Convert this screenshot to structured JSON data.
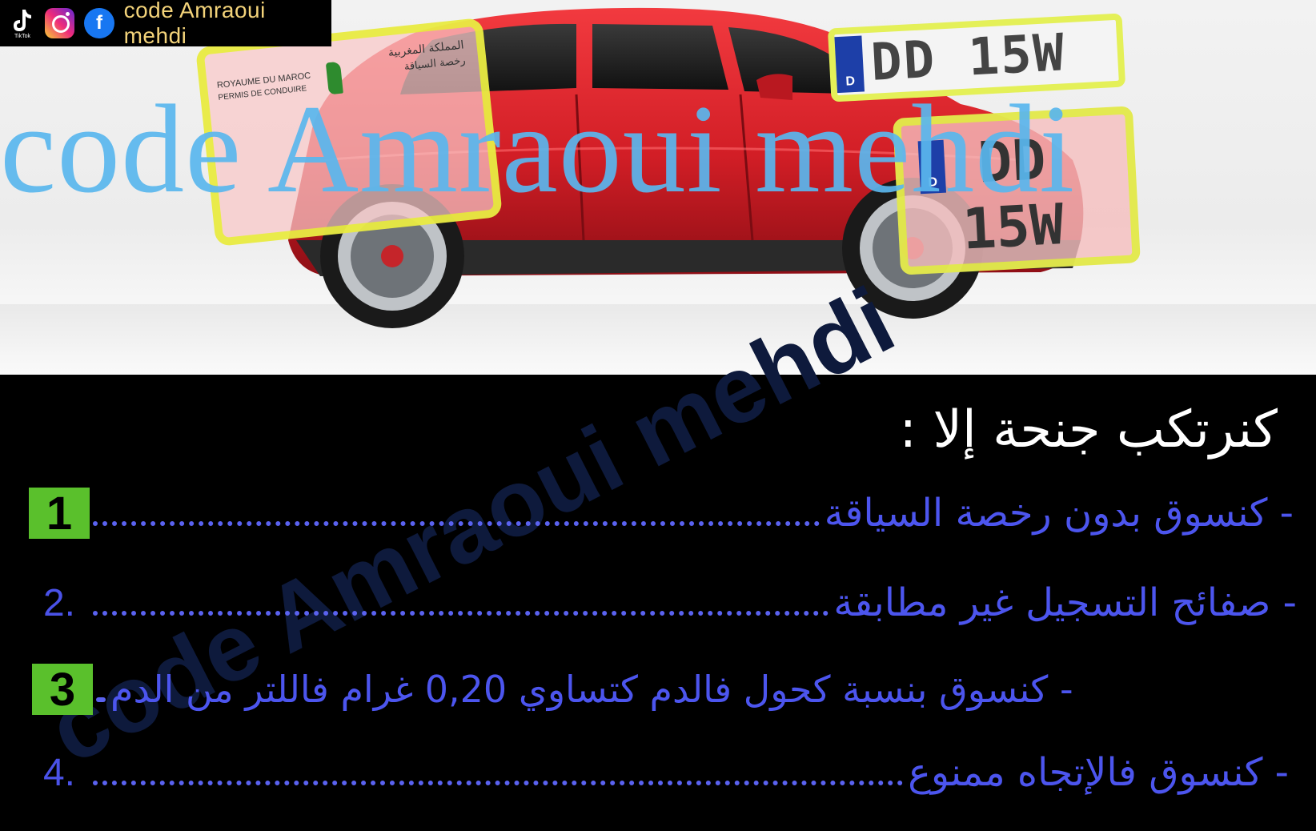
{
  "social": {
    "tiktok_label": "TikTok",
    "handle": "code Amraoui mehdi"
  },
  "watermark": "code Amraoui mehdi",
  "license_card": {
    "line1": "ROYAUME DU MAROC",
    "line2": "PERMIS DE CONDUIRE",
    "line1_ar": "المملكة المغربية",
    "line2_ar": "رخصة السياقة"
  },
  "plate_long": "DD 15W",
  "plate_square": {
    "top": "DD",
    "bottom": "15W"
  },
  "question": "كنرتكب جنحة إلا :",
  "answers": [
    {
      "number": "1",
      "text": "- كنسوق بدون رخصة السياقة",
      "highlighted": true
    },
    {
      "number": "2.",
      "text": "- صفائح التسجيل غير مطابقة",
      "highlighted": false
    },
    {
      "number": "3",
      "text": "- كنسوق بنسبة كحول فالدم كتساوي 0,20 غرام فاللتر من الدم",
      "highlighted": true
    },
    {
      "number": "4.",
      "text": "- كنسوق فالإتجاه ممنوع",
      "highlighted": false
    }
  ],
  "colors": {
    "answer_text": "#4c55ee",
    "number_highlight": "#5ac02c",
    "watermark": "#5ab7ee",
    "car_body": "#d8232b",
    "overlay_frame": "#e8ef3a"
  }
}
